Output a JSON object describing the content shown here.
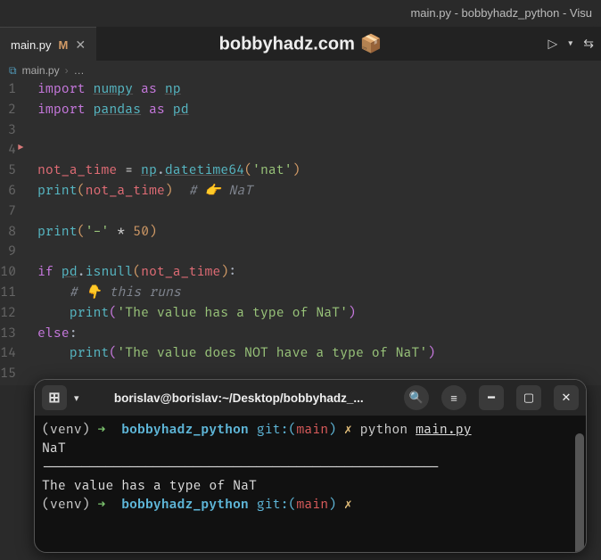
{
  "window": {
    "title": "main.py - bobbyhadz_python - Visu"
  },
  "tab": {
    "name": "main.py",
    "modified": "M"
  },
  "watermark": "bobbyhadz.com 📦",
  "breadcrumb": {
    "file": "main.py",
    "more": "…"
  },
  "gutter_lines": [
    "1",
    "2",
    "3",
    "4",
    "5",
    "6",
    "7",
    "8",
    "9",
    "10",
    "11",
    "12",
    "13",
    "14",
    "15"
  ],
  "code": {
    "l1": {
      "kw": "import",
      "mod": "numpy",
      "as": "as",
      "alias": "np"
    },
    "l2": {
      "kw": "import",
      "mod": "pandas",
      "as": "as",
      "alias": "pd"
    },
    "l5": {
      "var": "not_a_time",
      "eq": "=",
      "ns": "np",
      "dot": ".",
      "fn": "datetime64",
      "arg": "'nat'"
    },
    "l6": {
      "fn": "print",
      "arg": "not_a_time",
      "comm": "# 👉️ NaT"
    },
    "l8": {
      "fn": "print",
      "str": "'-'",
      "op": "*",
      "num": "50"
    },
    "l10": {
      "kw": "if",
      "ns": "pd",
      "dot": ".",
      "fn": "isnull",
      "arg": "not_a_time",
      "colon": ":"
    },
    "l11": {
      "comm": "# 👇️ this runs"
    },
    "l12": {
      "fn": "print",
      "str": "'The value has a type of NaT'"
    },
    "l13": {
      "kw": "else",
      "colon": ":"
    },
    "l14": {
      "fn": "print",
      "str": "'The value does NOT have a type of NaT'"
    }
  },
  "terminal": {
    "title": "borislav@borislav:~/Desktop/bobbyhadz_...",
    "prompt_venv": "(venv)",
    "prompt_arrow": "➜",
    "prompt_dir": "bobbyhadz_python",
    "prompt_git": "git:(",
    "prompt_branch": "main",
    "prompt_gitclose": ")",
    "prompt_x": "✗",
    "cmd": "python",
    "file": "main.py",
    "out1": "NaT",
    "out2": "--------------------------------------------------",
    "out3": "The value has a type of NaT"
  }
}
